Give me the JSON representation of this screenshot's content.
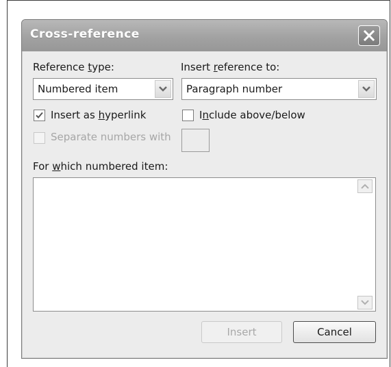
{
  "dialog": {
    "title": "Cross-reference",
    "reference_type": {
      "label": "Reference type:",
      "value": "Numbered item"
    },
    "insert_reference_to": {
      "label": "Insert reference to:",
      "value": "Paragraph number"
    },
    "insert_as_hyperlink": {
      "label": "Insert as hyperlink",
      "checked": true
    },
    "include_above_below": {
      "label": "Include above/below",
      "checked": false
    },
    "separate_numbers_with": {
      "label": "Separate numbers with",
      "checked": false,
      "enabled": false,
      "value": ""
    },
    "for_which": {
      "label": "For which numbered item:",
      "items": []
    },
    "buttons": {
      "insert": "Insert",
      "cancel": "Cancel"
    }
  },
  "icons": {
    "close": "close-icon",
    "dropdown": "chevron-down-icon",
    "check": "checkmark-icon",
    "scroll_up": "chevron-up-icon",
    "scroll_down": "chevron-down-icon"
  }
}
